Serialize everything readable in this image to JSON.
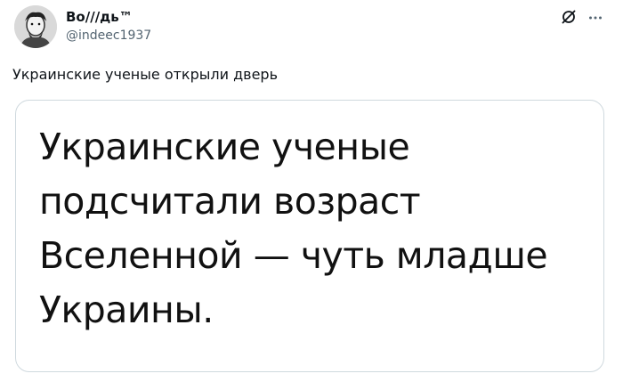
{
  "author": {
    "name": "Во///дь™",
    "handle": "@indeec1937",
    "avatar_icon": "portrait-avatar-icon"
  },
  "actions": {
    "grok_icon": "slashed-circle-icon",
    "more_icon": "more-dots-icon",
    "more_label": "···"
  },
  "tweet": {
    "text": "Украинские ученые открыли дверь"
  },
  "media": {
    "lines": [
      "Украинские ученые",
      "подсчитали возраст",
      "Вселенной — чуть младше",
      "Украины."
    ]
  },
  "colors": {
    "text": "#0f1419",
    "secondary": "#536471",
    "border": "#cfd9de"
  }
}
